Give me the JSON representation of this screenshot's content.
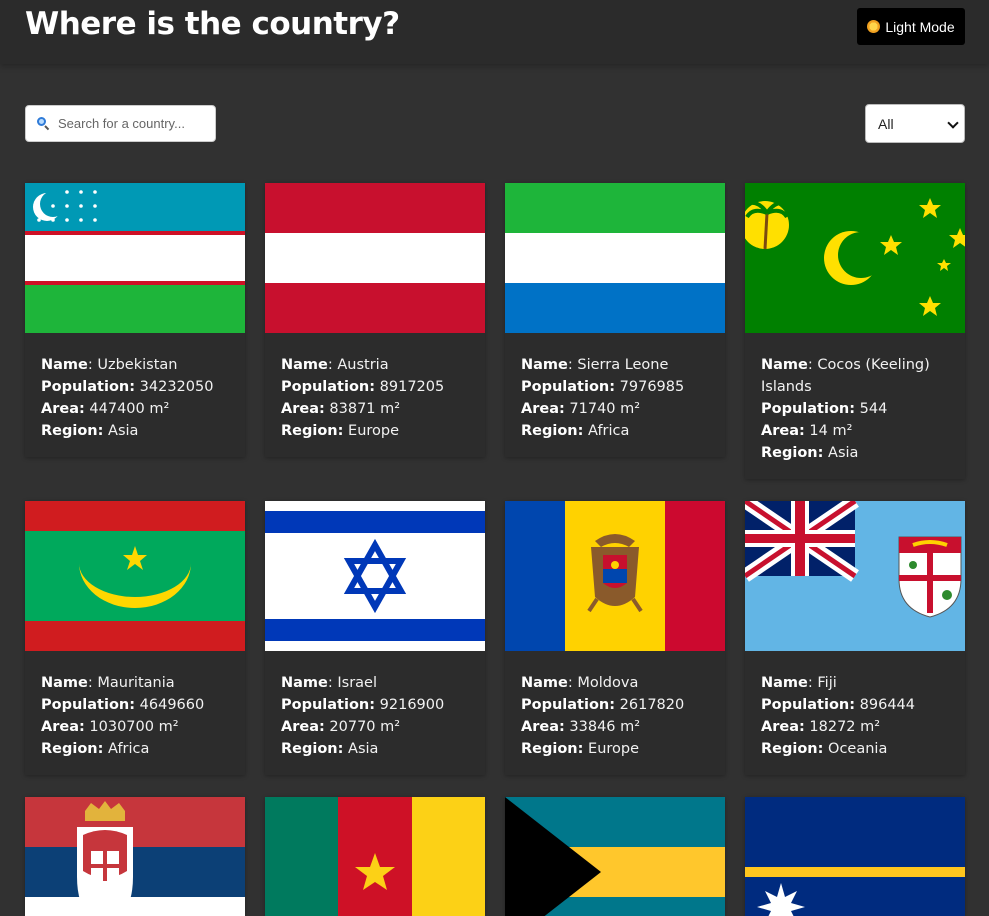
{
  "header": {
    "title": "Where is the country?",
    "mode_button_label": "Light Mode"
  },
  "search": {
    "placeholder": "Search for a country..."
  },
  "region_filter": {
    "selected": "All"
  },
  "labels": {
    "name": "Name",
    "population": "Population:",
    "area": "Area:",
    "region": "Region:",
    "area_unit": "m²"
  },
  "countries": [
    {
      "name": "Uzbekistan",
      "population": "34232050",
      "area": "447400 m²",
      "region": "Asia",
      "flag_icon": "uzbekistan-flag"
    },
    {
      "name": "Austria",
      "population": "8917205",
      "area": "83871 m²",
      "region": "Europe",
      "flag_icon": "austria-flag"
    },
    {
      "name": "Sierra Leone",
      "population": "7976985",
      "area": "71740 m²",
      "region": "Africa",
      "flag_icon": "sierra-leone-flag"
    },
    {
      "name": "Cocos (Keeling) Islands",
      "population": "544",
      "area": "14 m²",
      "region": "Asia",
      "flag_icon": "cocos-keeling-islands-flag"
    },
    {
      "name": "Mauritania",
      "population": "4649660",
      "area": "1030700 m²",
      "region": "Africa",
      "flag_icon": "mauritania-flag"
    },
    {
      "name": "Israel",
      "population": "9216900",
      "area": "20770 m²",
      "region": "Asia",
      "flag_icon": "israel-flag"
    },
    {
      "name": "Moldova",
      "population": "2617820",
      "area": "33846 m²",
      "region": "Europe",
      "flag_icon": "moldova-flag"
    },
    {
      "name": "Fiji",
      "population": "896444",
      "area": "18272 m²",
      "region": "Oceania",
      "flag_icon": "fiji-flag"
    }
  ],
  "partial_flags": [
    "serbia-flag",
    "cameroon-flag",
    "bahamas-flag",
    "nauru-flag"
  ],
  "colors": {
    "background": "#313131",
    "header": "#2b2b2b",
    "card": "#2c2c2c"
  }
}
